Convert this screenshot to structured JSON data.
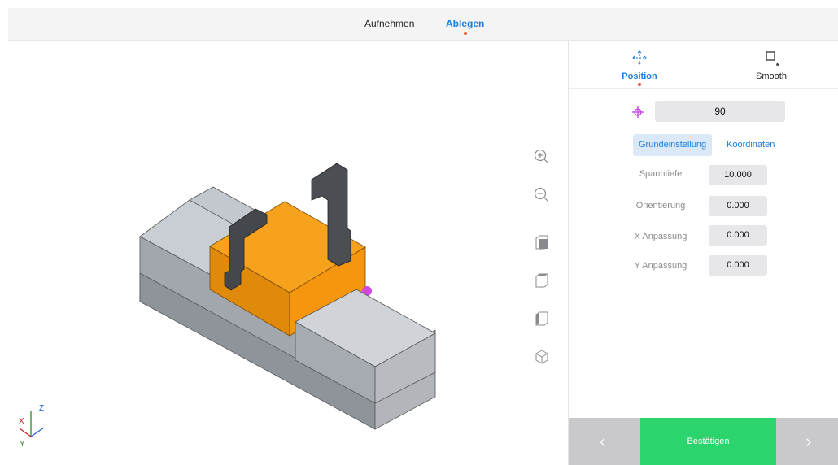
{
  "tabs": {
    "pick": "Aufnehmen",
    "place": "Ablegen",
    "active": "Ablegen"
  },
  "panel": {
    "tabs": {
      "position": "Position",
      "smooth": "Smooth"
    },
    "main_value": "90",
    "segments": {
      "basic": "Grundeinstellung",
      "coords": "Koordinaten"
    },
    "fields": [
      {
        "label": "Spanntiefe",
        "value": "10.000"
      },
      {
        "label": "Orientierung",
        "value": "0.000"
      },
      {
        "label": "X Anpassung",
        "value": "0.000"
      },
      {
        "label": "Y Anpassung",
        "value": "0.000"
      }
    ],
    "confirm": "Bestätigen",
    "prev_icon": "‹",
    "next_icon": "›"
  },
  "axes": {
    "x": "X",
    "y": "Y",
    "z": "Z"
  },
  "colors": {
    "accent": "#1a7fe0",
    "confirm": "#2bd46c",
    "workpiece": "#f59c0d",
    "indicator": "#f0512a"
  }
}
